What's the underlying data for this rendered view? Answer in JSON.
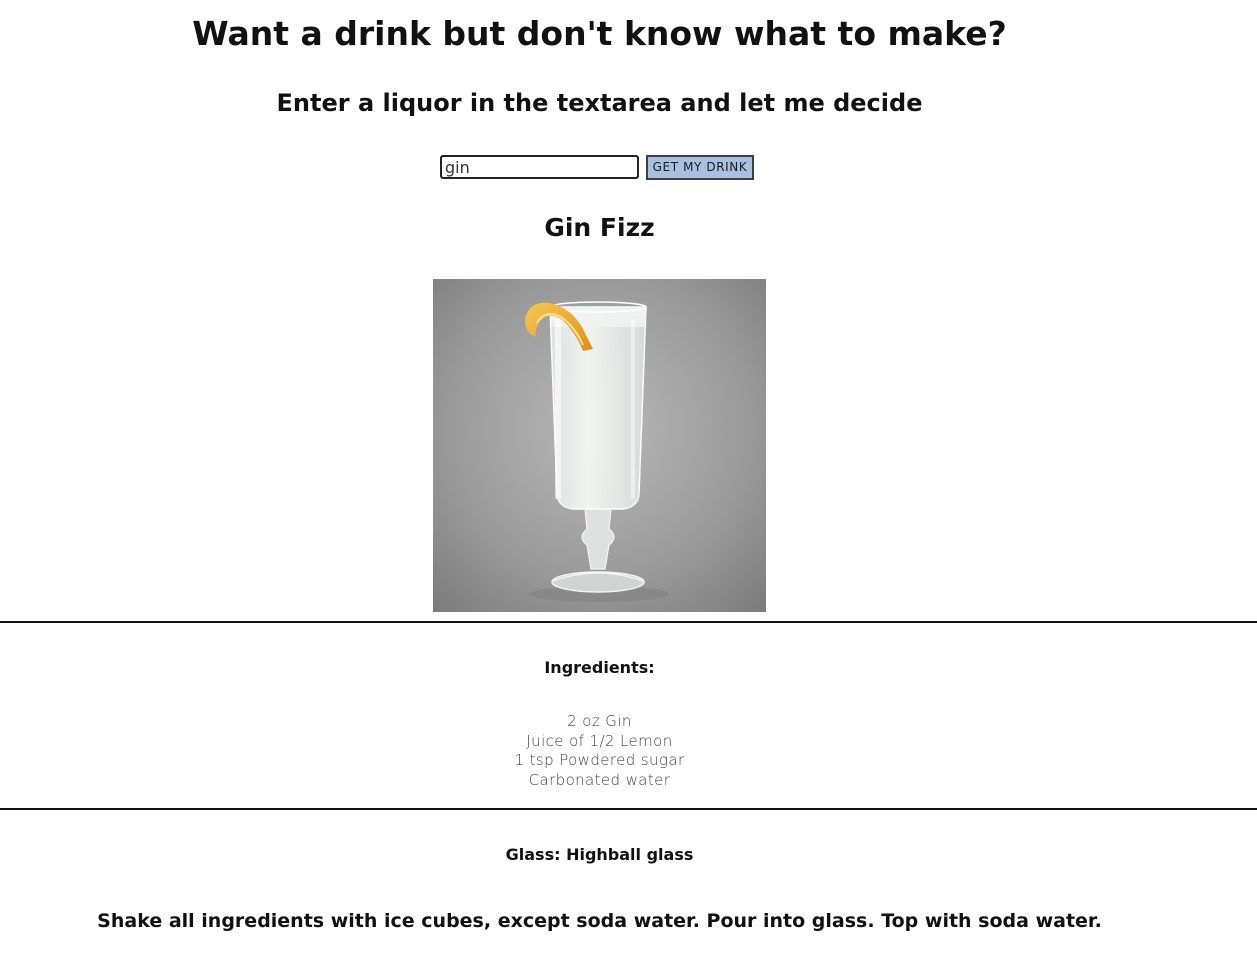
{
  "header": {
    "title": "Want a drink but don't know what to make?",
    "subtitle": "Enter a liquor in the textarea and let me decide"
  },
  "search": {
    "value": "gin",
    "button_label": "GET MY DRINK"
  },
  "drink": {
    "name": "Gin Fizz",
    "ingredients_heading": "Ingredients:",
    "ingredients": [
      "2 oz Gin",
      "Juice of 1/2 Lemon",
      "1 tsp Powdered sugar",
      "Carbonated water"
    ],
    "glass": "Glass: Highball glass",
    "instructions": "Shake all ingredients with ice cubes, except soda water. Pour into glass. Top with soda water."
  },
  "colors": {
    "button_bg": "#a9c0e0",
    "photo_bg": "#8a8a8a",
    "lemon_peel": "#e8a83a"
  },
  "icons": {
    "drink_photo": "highball-glass-with-lemon-peel-photo"
  }
}
